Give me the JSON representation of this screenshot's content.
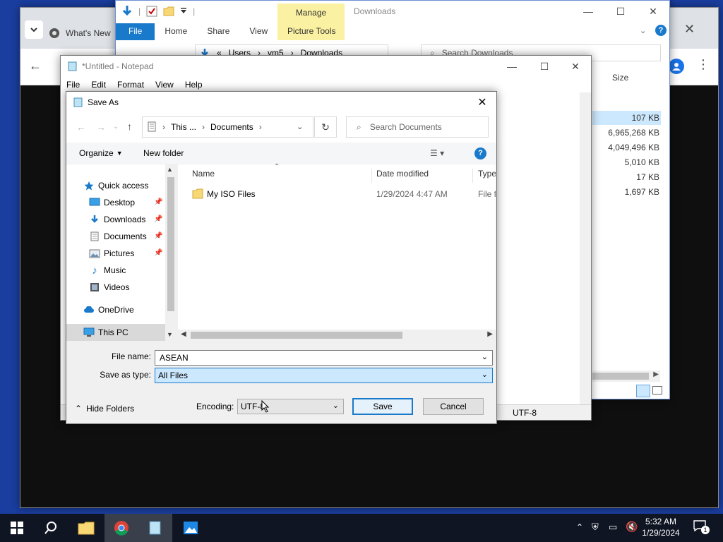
{
  "chrome": {
    "tab_title": "What's New"
  },
  "explorer": {
    "window_title": "Downloads",
    "ribbon_tabs": [
      "File",
      "Home",
      "Share",
      "View"
    ],
    "manage_label": "Manage",
    "picture_tools_label": "Picture Tools",
    "path": [
      "Users",
      "vm5",
      "Downloads"
    ],
    "path_prefix": "«",
    "search_placeholder": "Search Downloads",
    "size_header": "Size",
    "sizes": [
      "107 KB",
      "6,965,268 KB",
      "4,049,496 KB",
      "5,010 KB",
      "17 KB",
      "1,697 KB"
    ]
  },
  "notepad": {
    "title": "*Untitled - Notepad",
    "menu": [
      "File",
      "Edit",
      "Format",
      "View",
      "Help"
    ],
    "encoding_status": "UTF-8"
  },
  "save_dialog": {
    "title": "Save As",
    "breadcrumb": [
      "This ...",
      "Documents"
    ],
    "search_placeholder": "Search Documents",
    "organize_label": "Organize",
    "new_folder_label": "New folder",
    "nav": {
      "quick_access": "Quick access",
      "desktop": "Desktop",
      "downloads": "Downloads",
      "documents": "Documents",
      "pictures": "Pictures",
      "music": "Music",
      "videos": "Videos",
      "onedrive": "OneDrive",
      "this_pc": "This PC"
    },
    "columns": {
      "name": "Name",
      "date": "Date modified",
      "type": "Type"
    },
    "files": [
      {
        "name": "My ISO Files",
        "date": "1/29/2024 4:47 AM",
        "type": "File fo"
      }
    ],
    "file_name_label": "File name:",
    "file_name_value": "ASEAN",
    "save_type_label": "Save as type:",
    "save_type_value": "All Files",
    "hide_folders_label": "Hide Folders",
    "encoding_label": "Encoding:",
    "encoding_value": "UTF-8",
    "save_label": "Save",
    "cancel_label": "Cancel"
  },
  "taskbar": {
    "time": "5:32 AM",
    "date": "1/29/2024",
    "notification_count": "1"
  },
  "colors": {
    "desktop": "#1a3ea0",
    "accent": "#1979ca",
    "selection": "#cce8ff",
    "manage": "#fbf1a2"
  }
}
